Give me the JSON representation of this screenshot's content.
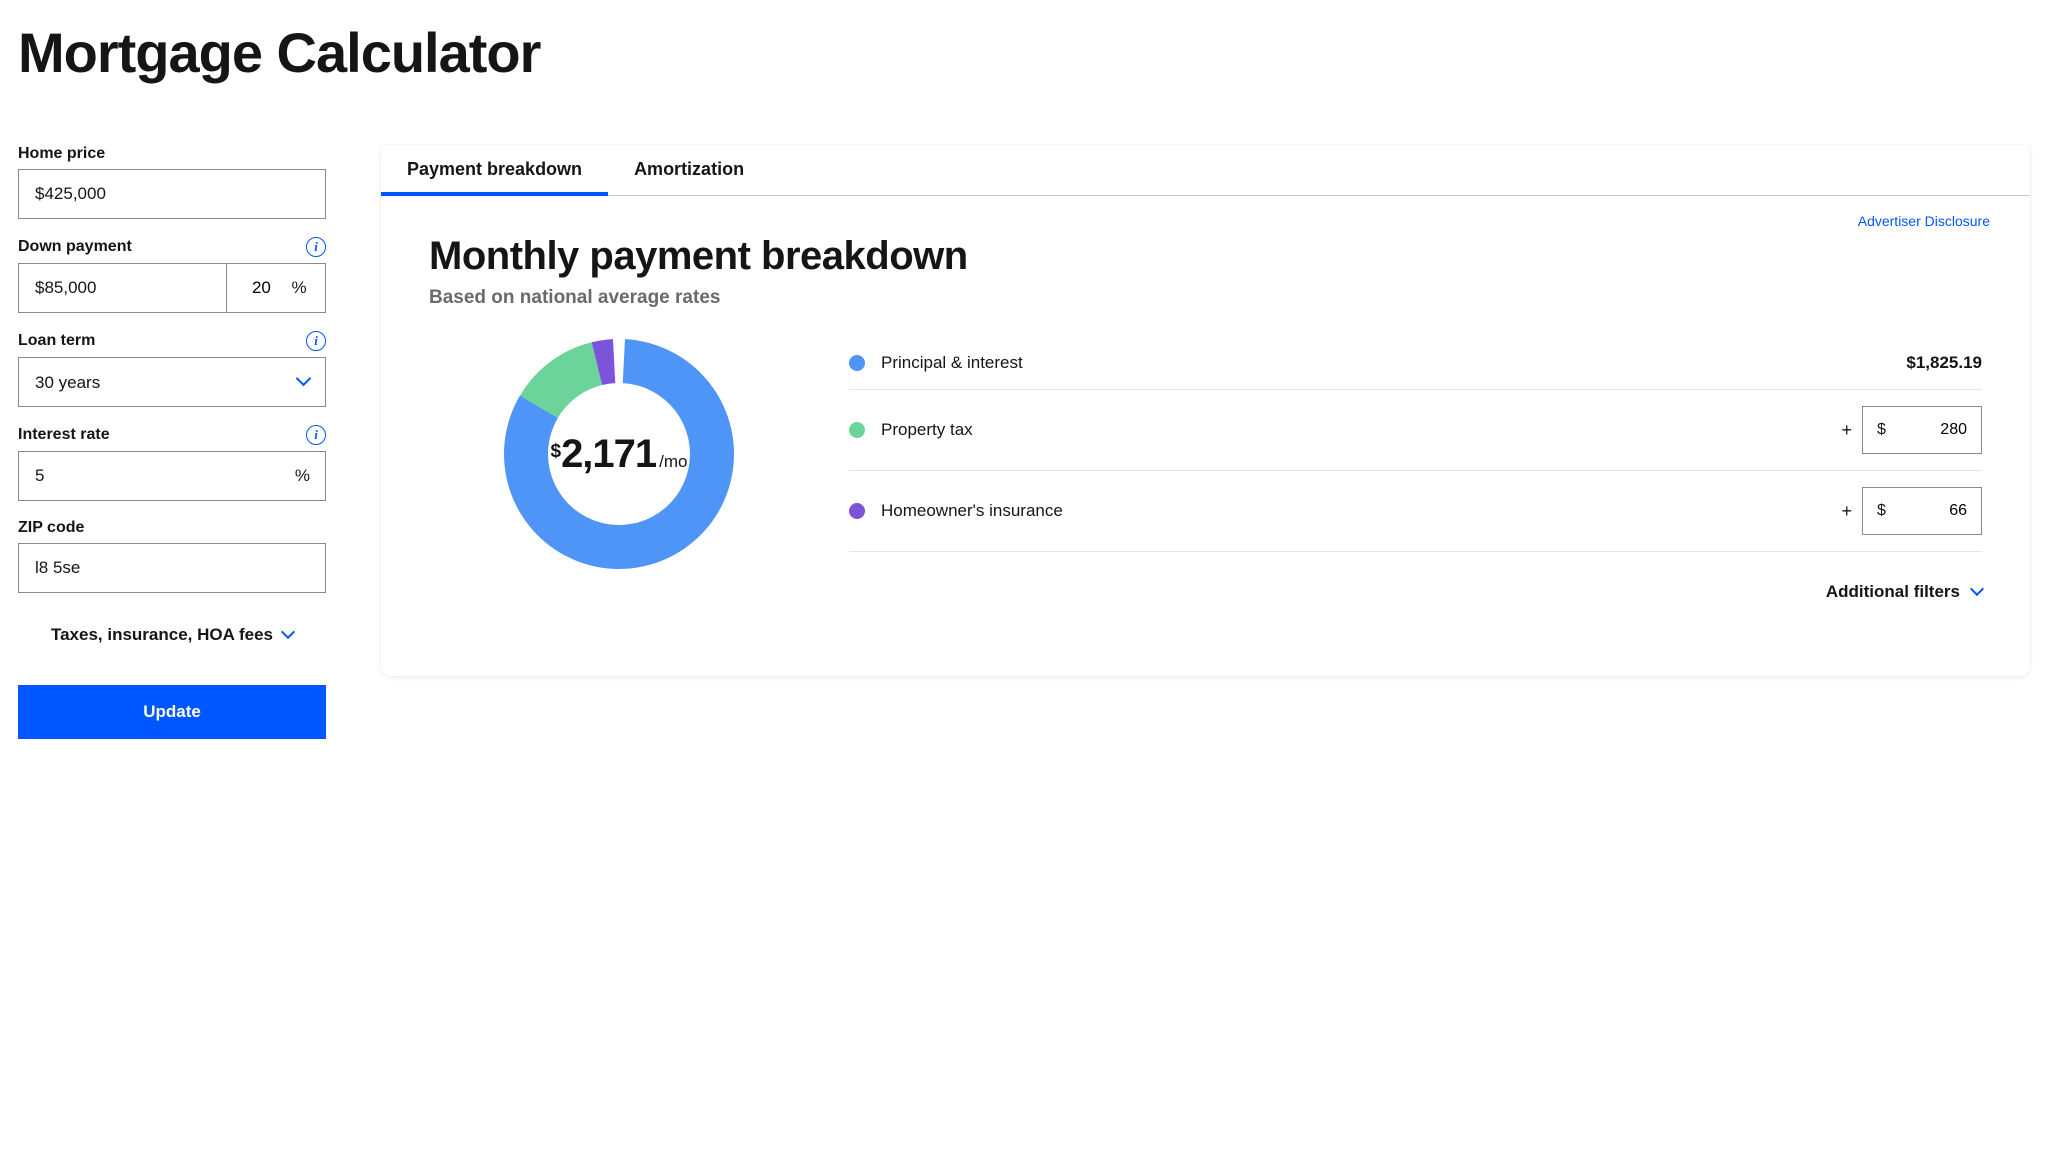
{
  "page_title": "Mortgage Calculator",
  "form": {
    "home_price": {
      "label": "Home price",
      "value": "$425,000"
    },
    "down_payment": {
      "label": "Down payment",
      "value": "$85,000",
      "pct": "20",
      "pct_suffix": "%"
    },
    "loan_term": {
      "label": "Loan term",
      "value": "30 years"
    },
    "interest_rate": {
      "label": "Interest rate",
      "value": "5",
      "suffix": "%"
    },
    "zip": {
      "label": "ZIP code",
      "value": "l8 5se"
    },
    "expand": "Taxes, insurance, HOA fees",
    "update": "Update"
  },
  "tabs": {
    "breakdown": "Payment breakdown",
    "amortization": "Amortization"
  },
  "disclosure": "Advertiser Disclosure",
  "breakdown": {
    "title": "Monthly payment breakdown",
    "subtitle": "Based on national average rates",
    "total_prefix": "$",
    "total": "2,171",
    "total_suffix": "/mo",
    "rows": {
      "pi": {
        "label": "Principal & interest",
        "value": "$1,825.19",
        "color": "#4f94f7"
      },
      "tax": {
        "label": "Property tax",
        "input": "280",
        "color": "#6cd49b"
      },
      "ins": {
        "label": "Homeowner's insurance",
        "input": "66",
        "color": "#7c54d9"
      }
    },
    "currency": "$",
    "plus": "+",
    "additional": "Additional filters"
  },
  "chart_data": {
    "type": "pie",
    "title": "Monthly payment breakdown",
    "series": [
      {
        "name": "Principal & interest",
        "value": 1825.19,
        "color": "#4f94f7"
      },
      {
        "name": "Property tax",
        "value": 280,
        "color": "#6cd49b"
      },
      {
        "name": "Homeowner's insurance",
        "value": 66,
        "color": "#7c54d9"
      }
    ],
    "total": 2171,
    "unit": "USD/mo"
  }
}
